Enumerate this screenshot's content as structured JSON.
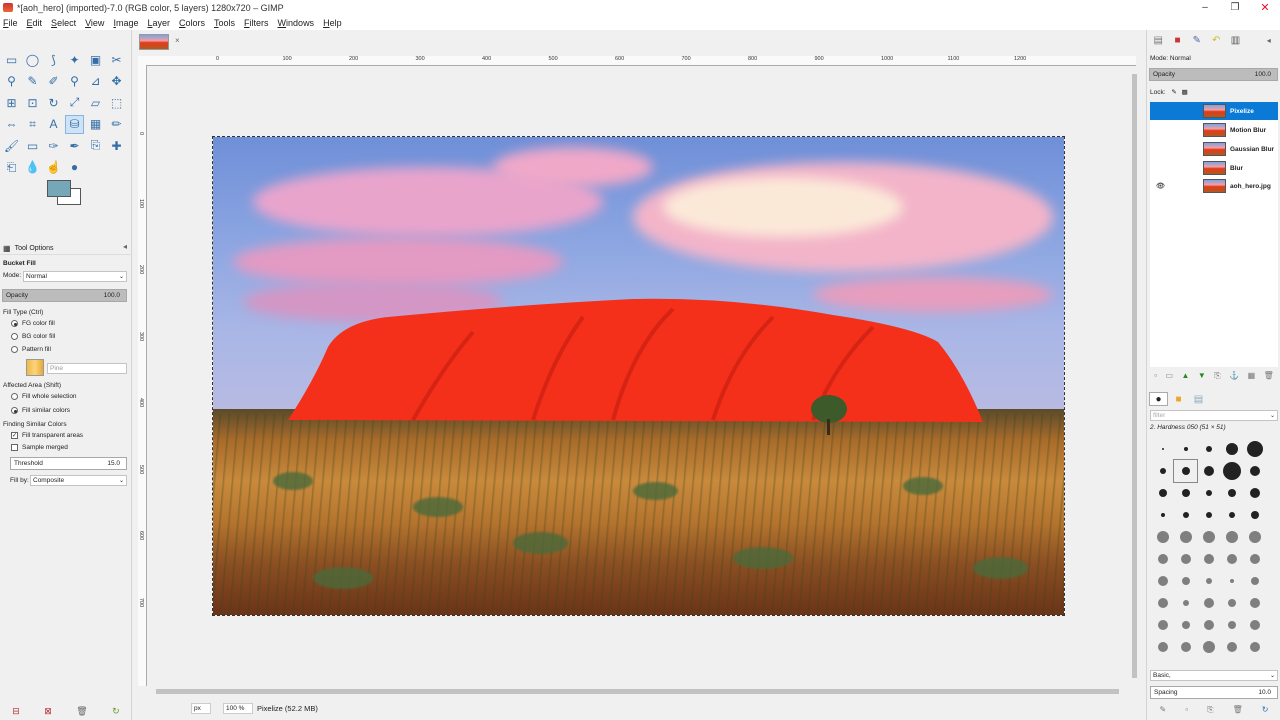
{
  "window": {
    "title": "*[aoh_hero] (imported)-7.0 (RGB color, 5 layers) 1280x720 – GIMP",
    "minimize": "–",
    "maximize": "❐",
    "close": "✕"
  },
  "menu": [
    "File",
    "Edit",
    "Select",
    "View",
    "Image",
    "Layer",
    "Colors",
    "Tools",
    "Filters",
    "Windows",
    "Help"
  ],
  "colors": {
    "foreground": "#76a7b9",
    "background": "#ffffff",
    "selection": "#0a7ad6"
  },
  "toolbox": {
    "tools": [
      "rect-select-icon",
      "ellipse-select-icon",
      "free-select-icon",
      "fuzzy-select-icon",
      "select-by-color-icon",
      "scissors-icon",
      "foreground-select-icon",
      "paths-icon",
      "color-picker-icon",
      "zoom-icon",
      "measure-icon",
      "move-icon",
      "align-icon",
      "crop-icon",
      "rotate-icon",
      "scale-icon",
      "shear-icon",
      "perspective-icon",
      "flip-icon",
      "cage-icon",
      "text-icon",
      "bucket-fill-icon",
      "gradient-icon",
      "pencil-icon",
      "paintbrush-icon",
      "eraser-icon",
      "airbrush-icon",
      "ink-icon",
      "clone-icon",
      "heal-icon",
      "perspective-clone-icon",
      "blur-icon",
      "smudge-icon",
      "dodge-burn-icon"
    ],
    "tool_glyphs": [
      "▭",
      "◯",
      "⟆",
      "✦",
      "▣",
      "✂",
      "⚲",
      "✎",
      "✐",
      "⚲",
      "⊿",
      "✥",
      "⊞",
      "⊡",
      "↻",
      "⤢",
      "▱",
      "⬚",
      "⇔",
      "⌗",
      "A",
      "⛁",
      "▦",
      "✏",
      "🖌",
      "▭",
      "✑",
      "✒",
      "⎘",
      "✚",
      "⎗",
      "💧",
      "☝",
      "●"
    ],
    "selected_tool_index": 21
  },
  "tool_options": {
    "tab_label": "Tool Options",
    "tool_name": "Bucket Fill",
    "mode_label": "Mode:",
    "mode_value": "Normal",
    "opacity_label": "Opacity",
    "opacity_value": "100.0",
    "fill_type_label": "Fill Type  (Ctrl)",
    "fill_type_options": [
      "FG color fill",
      "BG color fill",
      "Pattern fill"
    ],
    "pattern_name": "Pine",
    "affected_area_label": "Affected Area  (Shift)",
    "affected_area_options": [
      "Fill whole selection",
      "Fill similar colors"
    ],
    "finding_label": "Finding Similar Colors",
    "fill_transparent": "Fill transparent areas",
    "sample_merged": "Sample merged",
    "threshold_label": "Threshold",
    "threshold_value": "15.0",
    "fill_by_label": "Fill by:",
    "fill_by_value": "Composite"
  },
  "image": {
    "tab_close": "×",
    "ruler_ticks": [
      "0",
      "100",
      "200",
      "300",
      "400",
      "500",
      "600",
      "700",
      "800",
      "900",
      "1000",
      "1100",
      "1200"
    ],
    "unit": "px",
    "zoom": "100 %",
    "status": "Pixelize (52.2 MB)"
  },
  "dock": {
    "mode_label": "Mode: Normal",
    "opacity_label": "Opacity",
    "opacity_value": "100.0",
    "lock_label": "Lock:",
    "layers": [
      {
        "name": "Pixelize",
        "selected": true,
        "visible": false
      },
      {
        "name": "Motion Blur",
        "selected": false,
        "visible": false
      },
      {
        "name": "Gaussian Blur",
        "selected": false,
        "visible": false
      },
      {
        "name": "Blur",
        "selected": false,
        "visible": false
      },
      {
        "name": "aoh_hero.jpg",
        "selected": false,
        "visible": true
      }
    ],
    "eye_glyph": "👁",
    "brush_filter_placeholder": "filter",
    "brush_name": "2. Hardness 050 (51 × 51)",
    "brush_preset": "Basic,",
    "spacing_label": "Spacing",
    "spacing_value": "10.0"
  }
}
